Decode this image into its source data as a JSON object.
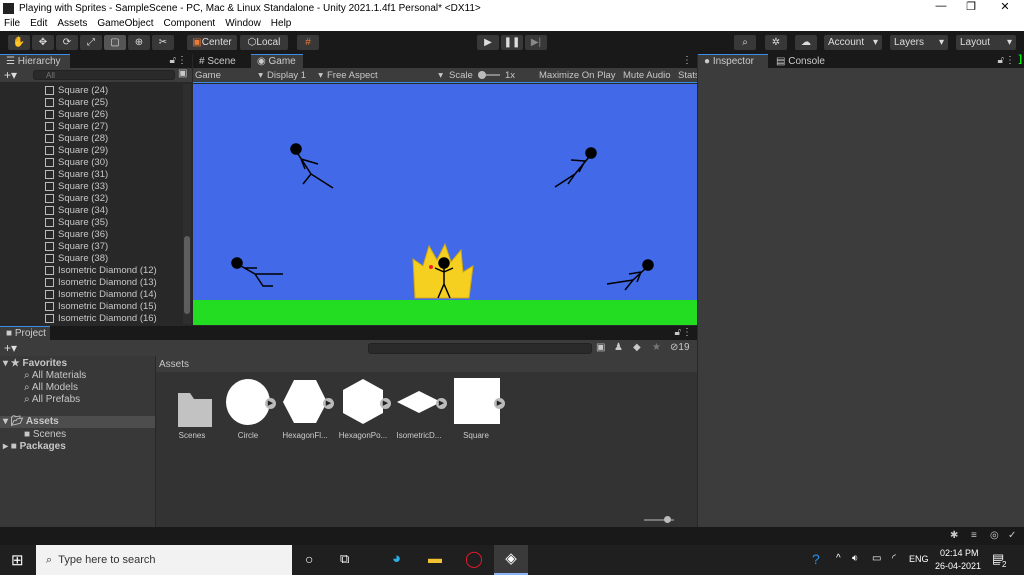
{
  "window": {
    "title": "Playing with Sprites - SampleScene - PC, Mac & Linux Standalone - Unity 2021.1.4f1 Personal* <DX11>"
  },
  "menu": [
    "File",
    "Edit",
    "Assets",
    "GameObject",
    "Component",
    "Window",
    "Help"
  ],
  "toolbar": {
    "center": "Center",
    "local": "Local",
    "account": "Account",
    "layers": "Layers",
    "layout": "Layout"
  },
  "hierarchy": {
    "title": "Hierarchy",
    "search_placeholder": "All",
    "items": [
      "Square (24)",
      "Square (25)",
      "Square (26)",
      "Square (27)",
      "Square (28)",
      "Square (29)",
      "Square (30)",
      "Square (31)",
      "Square (33)",
      "Square (32)",
      "Square (34)",
      "Square (35)",
      "Square (36)",
      "Square (37)",
      "Square (38)",
      "Isometric Diamond (12)",
      "Isometric Diamond (13)",
      "Isometric Diamond (14)",
      "Isometric Diamond (15)",
      "Isometric Diamond (16)"
    ]
  },
  "game": {
    "tabs": [
      "Scene",
      "Game"
    ],
    "view": "Game",
    "display": "Display 1",
    "aspect": "Free Aspect",
    "scale_label": "Scale",
    "scale_value": "1x",
    "maximize": "Maximize On Play",
    "mute": "Mute Audio",
    "stats": "Stats",
    "colors": {
      "sky": "#4169e8",
      "ground": "#22dd22",
      "aura": "#f5d020"
    }
  },
  "inspector": {
    "tabs": [
      "Inspector",
      "Console"
    ]
  },
  "project": {
    "title": "Project",
    "hidden_count": "19",
    "favorites": {
      "label": "Favorites",
      "items": [
        "All Materials",
        "All Models",
        "All Prefabs"
      ]
    },
    "assets_tree": "Assets",
    "scenes": "Scenes",
    "packages": "Packages",
    "breadcrumb": "Assets",
    "assets": [
      "Scenes",
      "Circle",
      "HexagonFl...",
      "HexagonPo...",
      "IsometricD...",
      "Square"
    ]
  },
  "taskbar": {
    "search_placeholder": "Type here to search",
    "lang": "ENG",
    "time": "02:14 PM",
    "date": "26-04-2021",
    "notifications": "2"
  }
}
